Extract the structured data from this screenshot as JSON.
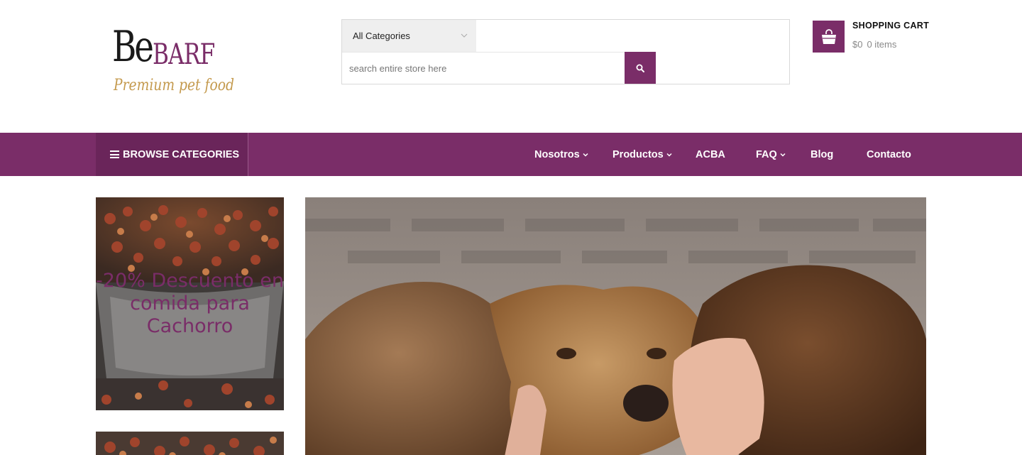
{
  "header": {
    "logo": {
      "main_be": "Be",
      "main_barf": "BARF",
      "tagline": "Premium pet food"
    },
    "search": {
      "category_selected": "All Categories",
      "placeholder": "search entire store here"
    },
    "cart": {
      "title": "SHOPPING CART",
      "amount": "$0",
      "items": "0 items"
    }
  },
  "nav": {
    "browse_label": "BROWSE CATEGORIES",
    "items": [
      {
        "label": "Nosotros",
        "has_dropdown": true
      },
      {
        "label": "Productos",
        "has_dropdown": true
      },
      {
        "label": "ACBA",
        "has_dropdown": false
      },
      {
        "label": "FAQ",
        "has_dropdown": true
      },
      {
        "label": "Blog",
        "has_dropdown": false
      },
      {
        "label": "Contacto",
        "has_dropdown": false
      }
    ]
  },
  "main": {
    "promo": {
      "text": "-20% Descuento en comida para Cachorro"
    }
  },
  "colors": {
    "brand": "#7a2d68",
    "brand_dark": "#6a255a",
    "logo_gold": "#c49a4e",
    "select_bg": "#efefef"
  },
  "icons": {
    "cart": "shopping-bag-icon",
    "search": "search-icon",
    "menu": "hamburger-icon",
    "dropdown": "chevron-down-icon"
  }
}
